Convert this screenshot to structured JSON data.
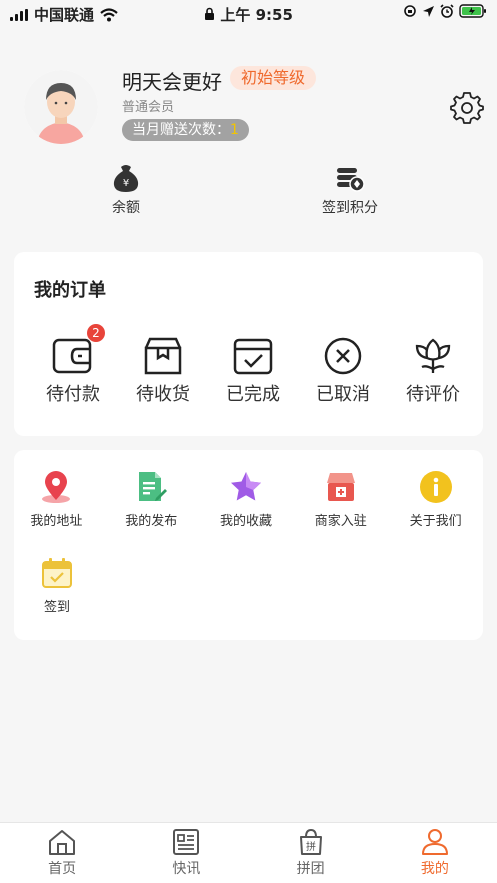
{
  "status_bar": {
    "carrier": "中国联通",
    "time": "上午 9:55"
  },
  "profile": {
    "nickname": "明天会更好",
    "level": "初始等级",
    "member_type": "普通会员",
    "gift_label": "当月赠送次数：",
    "gift_count": "1"
  },
  "quick_actions": [
    {
      "label": "余额",
      "icon": "money-bag-icon"
    },
    {
      "label": "签到积分",
      "icon": "coins-icon"
    }
  ],
  "orders": {
    "title": "我的订单",
    "items": [
      {
        "label": "待付款",
        "icon": "wallet-icon",
        "badge": "2"
      },
      {
        "label": "待收货",
        "icon": "package-icon"
      },
      {
        "label": "已完成",
        "icon": "calendar-check-icon"
      },
      {
        "label": "已取消",
        "icon": "cancel-circle-icon"
      },
      {
        "label": "待评价",
        "icon": "flower-icon"
      }
    ]
  },
  "services": [
    {
      "label": "我的地址",
      "icon": "location-pin-icon"
    },
    {
      "label": "我的发布",
      "icon": "document-edit-icon"
    },
    {
      "label": "我的收藏",
      "icon": "star-icon"
    },
    {
      "label": "商家入驻",
      "icon": "shop-icon"
    },
    {
      "label": "关于我们",
      "icon": "info-icon"
    },
    {
      "label": "签到",
      "icon": "calendar-icon"
    }
  ],
  "tab_bar": {
    "active": "我的",
    "tabs": [
      {
        "label": "首页",
        "icon": "home-icon"
      },
      {
        "label": "快讯",
        "icon": "news-icon"
      },
      {
        "label": "拼团",
        "icon": "group-buy-icon",
        "icon_text": "拼"
      },
      {
        "label": "我的",
        "icon": "user-icon"
      }
    ]
  },
  "colors": {
    "accent": "#ef6a2e",
    "badge_red": "#e8443a",
    "pill_gray": "#a2a2a2",
    "count_yellow": "#f2c500"
  }
}
